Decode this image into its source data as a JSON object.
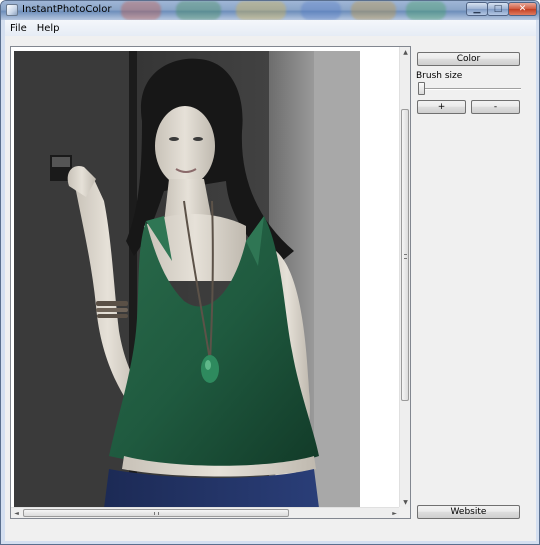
{
  "window": {
    "title": "InstantPhotoColor",
    "minimize_glyph": "▁",
    "maximize_glyph": "□",
    "close_glyph": "✕"
  },
  "menu": {
    "items": [
      {
        "label": "File"
      },
      {
        "label": "Help"
      }
    ]
  },
  "controls": {
    "color_button": "Color",
    "brush_size_label": "Brush size",
    "brush_size_level": 0.0,
    "plus_button": "+",
    "minus_button": "-",
    "website_button": "Website"
  },
  "image_panel": {
    "vertical_scroll_glyphs": {
      "up": "▲",
      "down": "▼"
    },
    "horizontal_scroll_glyphs": {
      "left": "◄",
      "right": "►"
    }
  },
  "icons": [
    "app-icon",
    "photo-image"
  ],
  "colors": {
    "titlebar": "#8ca6c9",
    "close_button": "#c13e22",
    "client_background": "#f0f0f0",
    "dress_accent": "#1f5a3f"
  }
}
